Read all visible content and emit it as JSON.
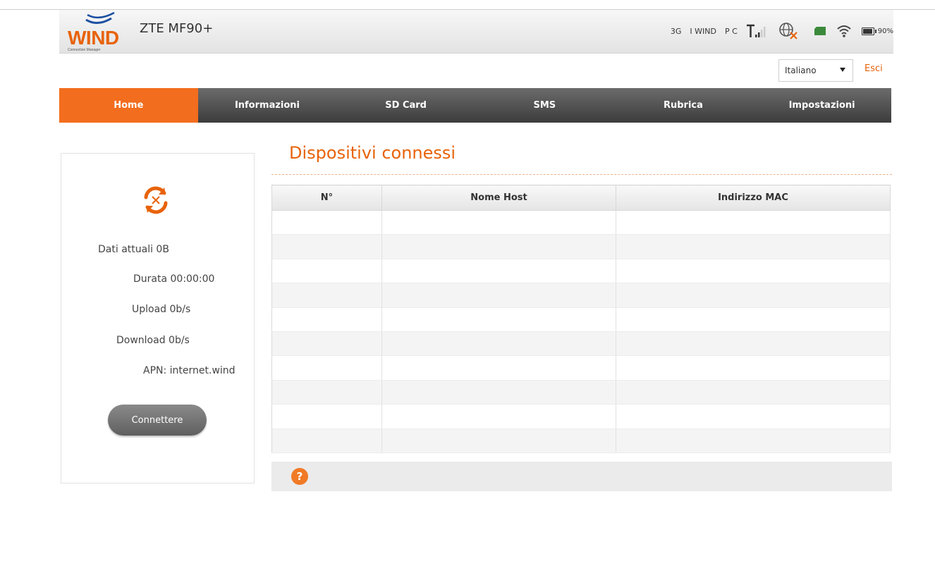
{
  "header": {
    "logo_text": "WIND",
    "logo_subtext": "Connection Manager",
    "device_model": "ZTE MF90+",
    "status": {
      "network_type": "3G",
      "operator": "I WIND",
      "pc_label": "P C",
      "battery_level": "90%",
      "icons": [
        "signal-icon",
        "globe-disconnected-icon",
        "sim-card-icon",
        "wifi-icon",
        "battery-icon"
      ]
    }
  },
  "language": {
    "selected": "Italiano"
  },
  "logout_label": "Esci",
  "nav": {
    "items": [
      {
        "label": "Home",
        "active": true
      },
      {
        "label": "Informazioni",
        "active": false
      },
      {
        "label": "SD Card",
        "active": false
      },
      {
        "label": "SMS",
        "active": false
      },
      {
        "label": "Rubrica",
        "active": false
      },
      {
        "label": "Impostazioni",
        "active": false
      }
    ]
  },
  "sidebar": {
    "current_data": "Dati attuali 0B",
    "duration": "Durata 00:00:00",
    "upload": "Upload 0b/s",
    "download": "Download 0b/s",
    "apn": "APN: internet.wind",
    "connect_button": "Connettere"
  },
  "main": {
    "title": "Dispositivi connessi",
    "table": {
      "columns": [
        "N°",
        "Nome Host",
        "Indirizzo MAC"
      ],
      "row_count": 10
    }
  },
  "colors": {
    "accent": "#f26d1d",
    "nav_bg": "#4a4a4a"
  }
}
